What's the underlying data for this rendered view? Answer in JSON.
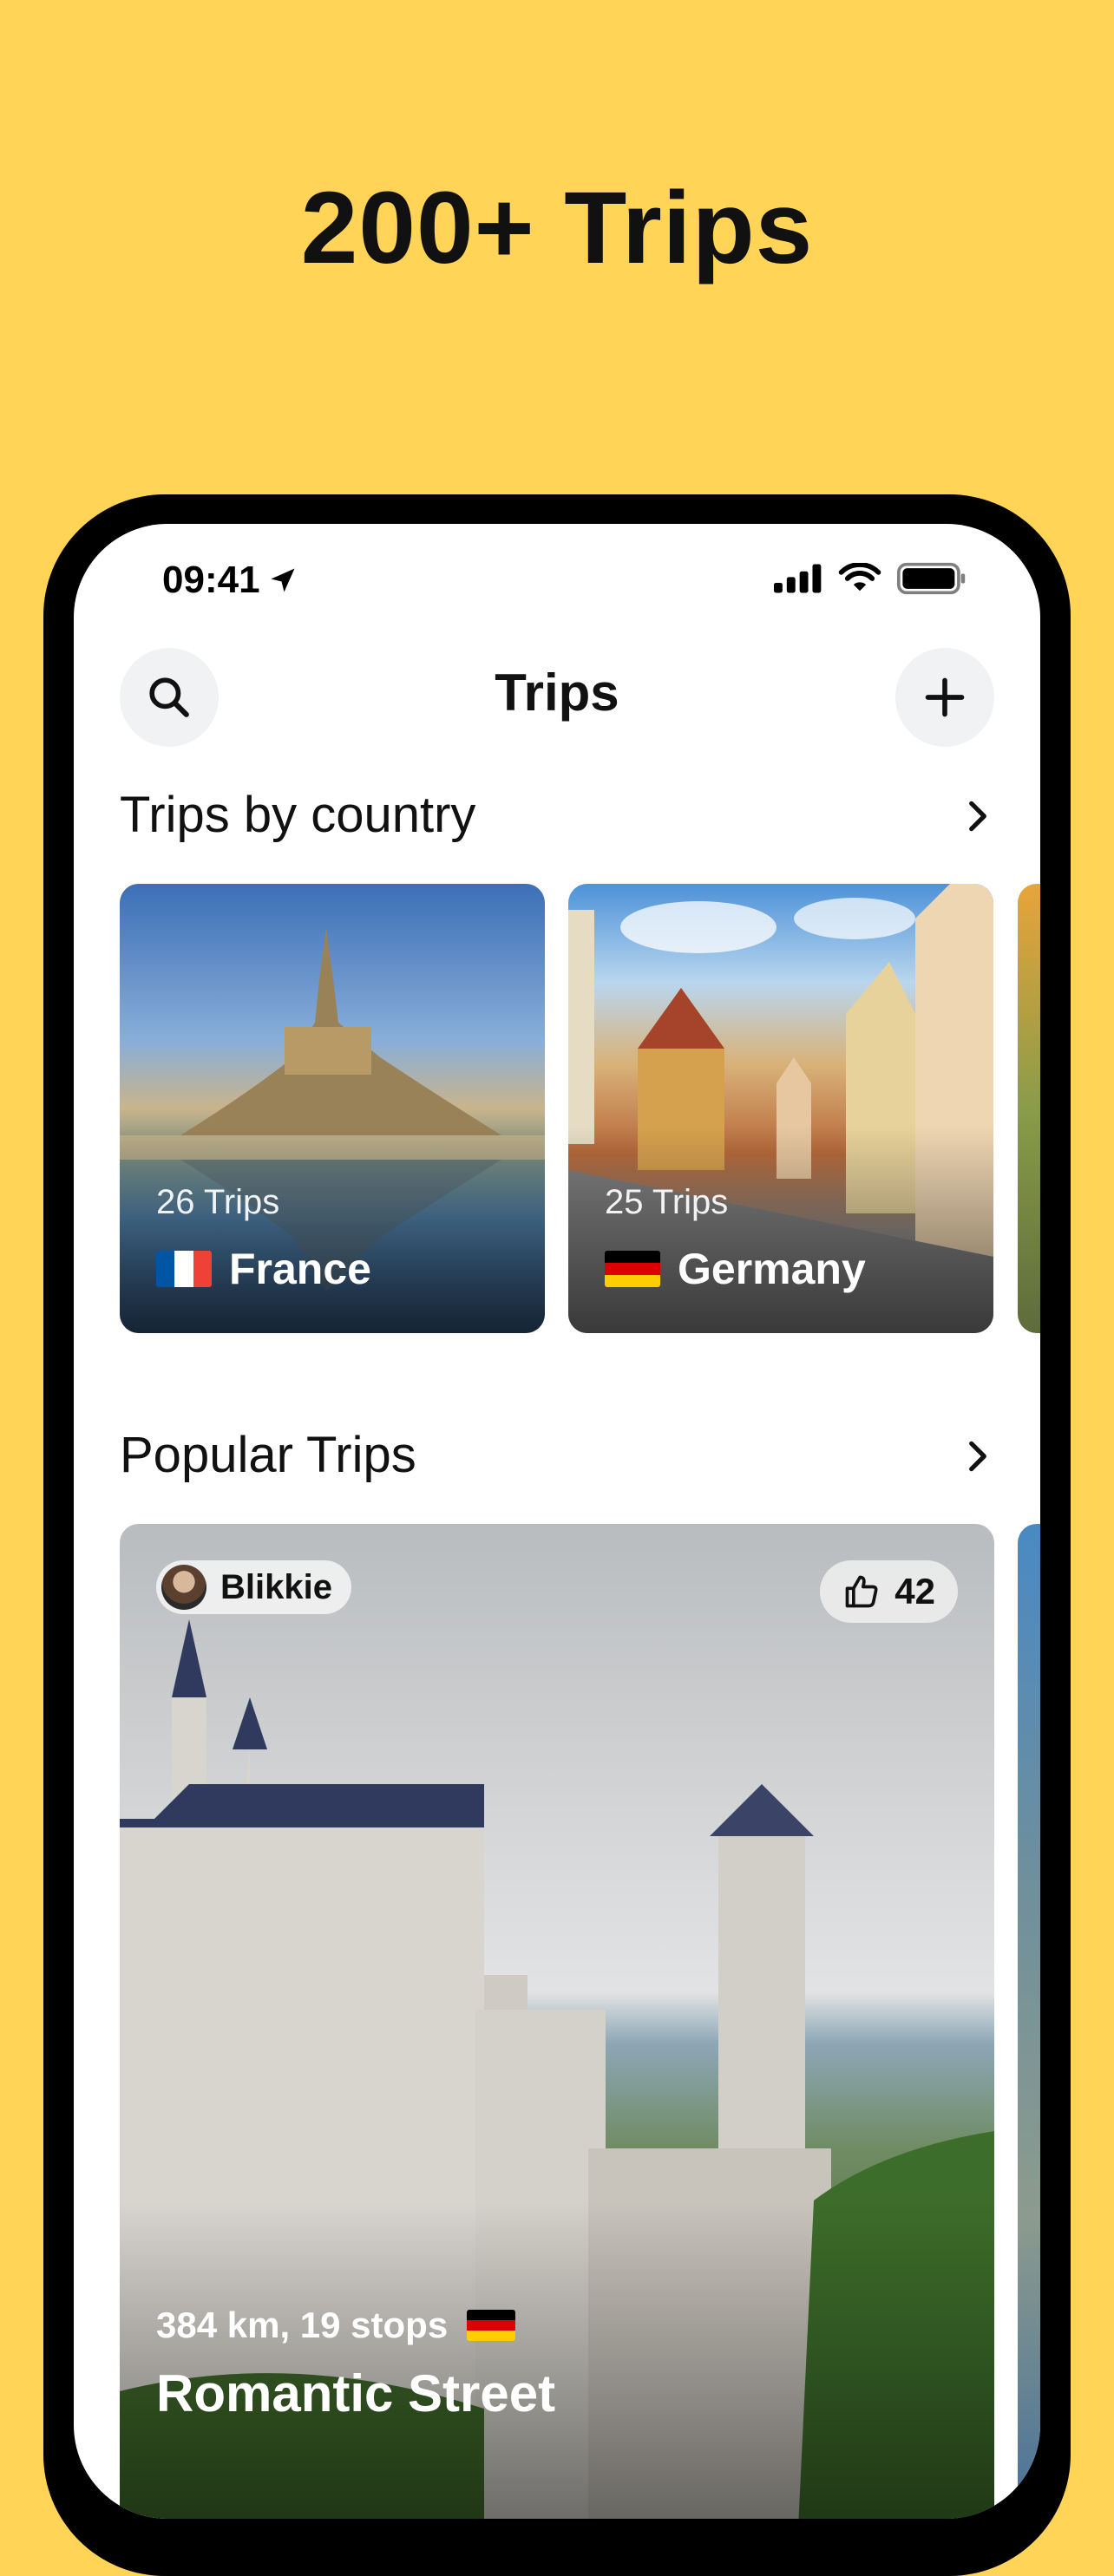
{
  "promo": {
    "headline": "200+ Trips"
  },
  "status_bar": {
    "time": "09:41",
    "icons": [
      "location-arrow-icon",
      "cellular-signal-icon",
      "wifi-icon",
      "battery-icon"
    ]
  },
  "nav": {
    "title": "Trips",
    "left_button_icon": "search-icon",
    "right_button_icon": "plus-icon"
  },
  "trips_by_country": {
    "title": "Trips by country",
    "chevron_icon": "chevron-right-icon",
    "cards": [
      {
        "count_label": "26 Trips",
        "country": "France",
        "flag": "flag-france-icon"
      },
      {
        "count_label": "25 Trips",
        "country": "Germany",
        "flag": "flag-germany-icon"
      }
    ]
  },
  "popular_trips": {
    "title": "Popular Trips",
    "chevron_icon": "chevron-right-icon",
    "cards": [
      {
        "author": "Blikkie",
        "likes": "42",
        "like_icon": "thumbs-up-icon",
        "meta": "384 km, 19 stops",
        "flag": "flag-germany-icon",
        "name": "Romantic Street"
      }
    ]
  },
  "colors": {
    "background": "#FFD457",
    "france_blue": "#0055A4",
    "france_red": "#EF4135",
    "germany_black": "#000000",
    "germany_red": "#DD0000",
    "germany_gold": "#FFCE00"
  }
}
